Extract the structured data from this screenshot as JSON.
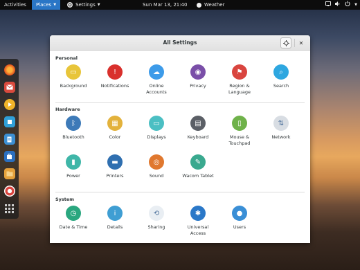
{
  "topbar": {
    "activities": "Activities",
    "places": "Places",
    "app_menu": "Settings",
    "clock": "Sun Mar 13, 21:40",
    "weather": "Weather"
  },
  "window": {
    "title": "All Settings"
  },
  "sections": {
    "personal": {
      "title": "Personal",
      "items": [
        {
          "label": "Background",
          "icon": "background-icon",
          "color": "#e8c53a"
        },
        {
          "label": "Notifications",
          "icon": "notifications-icon",
          "color": "#d9302c"
        },
        {
          "label": "Online\nAccounts",
          "icon": "online-accounts-icon",
          "color": "#3d9be9"
        },
        {
          "label": "Privacy",
          "icon": "privacy-icon",
          "color": "#7a4fa8"
        },
        {
          "label": "Region &\nLanguage",
          "icon": "region-language-icon",
          "color": "#d9453f"
        },
        {
          "label": "Search",
          "icon": "search-icon",
          "color": "#2ea7e0"
        }
      ]
    },
    "hardware": {
      "title": "Hardware",
      "items": [
        {
          "label": "Bluetooth",
          "icon": "bluetooth-icon",
          "color": "#3d7ab8"
        },
        {
          "label": "Color",
          "icon": "color-icon",
          "color": "#e3b23c"
        },
        {
          "label": "Displays",
          "icon": "displays-icon",
          "color": "#4bbfc3"
        },
        {
          "label": "Keyboard",
          "icon": "keyboard-icon",
          "color": "#5b5f66"
        },
        {
          "label": "Mouse &\nTouchpad",
          "icon": "mouse-touchpad-icon",
          "color": "#6fb24a"
        },
        {
          "label": "Network",
          "icon": "network-icon",
          "color": "#d8dde3"
        },
        {
          "label": "Power",
          "icon": "power-icon",
          "color": "#3fb6a8"
        },
        {
          "label": "Printers",
          "icon": "printers-icon",
          "color": "#2f6fb0"
        },
        {
          "label": "Sound",
          "icon": "sound-icon",
          "color": "#e0782f"
        },
        {
          "label": "Wacom Tablet",
          "icon": "wacom-tablet-icon",
          "color": "#3aa98f"
        }
      ]
    },
    "system": {
      "title": "System",
      "items": [
        {
          "label": "Date & Time",
          "icon": "date-time-icon",
          "color": "#2aa77f"
        },
        {
          "label": "Details",
          "icon": "details-icon",
          "color": "#3f9ed3"
        },
        {
          "label": "Sharing",
          "icon": "sharing-icon",
          "color": "#e9eef3"
        },
        {
          "label": "Universal\nAccess",
          "icon": "universal-access-icon",
          "color": "#2a78c8"
        },
        {
          "label": "Users",
          "icon": "users-icon",
          "color": "#3a8fd6"
        }
      ]
    }
  }
}
